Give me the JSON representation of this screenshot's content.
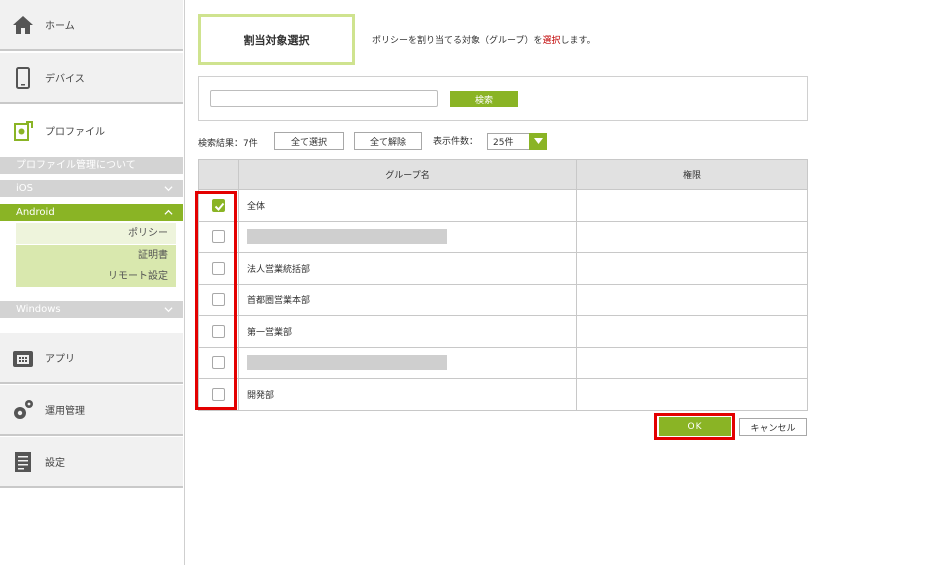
{
  "sidebar": {
    "home": {
      "label": "ホーム",
      "icon": "home-icon"
    },
    "device": {
      "label": "デバイス",
      "icon": "smartphone-icon"
    },
    "profile": {
      "label": "プロファイル",
      "icon": "profile-icon"
    },
    "profile_about": "プロファイル管理について",
    "ios": "iOS",
    "android": "Android",
    "android_items": [
      "ポリシー",
      "証明書",
      "リモート設定"
    ],
    "windows": "Windows",
    "app": {
      "label": "アプリ",
      "icon": "app-icon"
    },
    "ops": {
      "label": "運用管理",
      "icon": "gears-icon"
    },
    "settings": {
      "label": "設定",
      "icon": "settings-icon"
    }
  },
  "header": {
    "title": "割当対象選択",
    "desc_before": "ポリシーを割り当てる対象（グループ）を",
    "desc_highlight": "選択",
    "desc_after": "します。"
  },
  "search": {
    "input_value": "",
    "button_label": "検索"
  },
  "results": {
    "summary": "検索結果：7件",
    "select_all": "全て選択",
    "clear_all": "全て解除",
    "per_page_label": "表示件数：",
    "per_page_value": "25件"
  },
  "table": {
    "columns": [
      "",
      "グループ名",
      "権限"
    ],
    "rows": [
      {
        "name": "全体",
        "checked": true,
        "redacted": false
      },
      {
        "name": "",
        "checked": false,
        "redacted": true
      },
      {
        "name": "法人営業統括部",
        "checked": false,
        "redacted": false
      },
      {
        "name": "首都圏営業本部",
        "checked": false,
        "redacted": false
      },
      {
        "name": "第一営業部",
        "checked": false,
        "redacted": false
      },
      {
        "name": "",
        "checked": false,
        "redacted": true
      },
      {
        "name": "開発部",
        "checked": false,
        "redacted": false
      }
    ]
  },
  "footer": {
    "ok": "OK",
    "cancel": "キャンセル"
  },
  "colors": {
    "accent": "#8ab425",
    "highlight": "#e30000",
    "emphasis_text": "#c00000"
  }
}
